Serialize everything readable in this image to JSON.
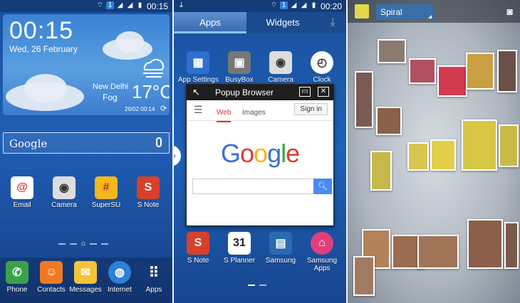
{
  "panel1": {
    "status": {
      "time": "00:15"
    },
    "weather": {
      "time": "00:15",
      "date": "Wed, 26 February",
      "city": "New Delhi",
      "condition": "Fog",
      "temperature": "17°C",
      "updated": "26/02 00:14"
    },
    "search": {
      "label": "Google"
    },
    "apps": [
      {
        "label": "Email",
        "icon": "email-icon",
        "color": "#ffffff"
      },
      {
        "label": "Camera",
        "icon": "camera-icon",
        "color": "#dddddd"
      },
      {
        "label": "SuperSU",
        "icon": "supersu-icon",
        "color": "#f2b81c"
      },
      {
        "label": "S Note",
        "icon": "s-note-icon",
        "color": "#d8402b"
      }
    ],
    "dock": [
      {
        "label": "Phone",
        "icon": "phone-icon",
        "color": "#3aa14a"
      },
      {
        "label": "Contacts",
        "icon": "contacts-icon",
        "color": "#f07a22"
      },
      {
        "label": "Messages",
        "icon": "messages-icon",
        "color": "#f3c43a"
      },
      {
        "label": "Internet",
        "icon": "internet-icon",
        "color": "#2e7fd6"
      },
      {
        "label": "Apps",
        "icon": "apps-grid-icon",
        "color": "#ffffff"
      }
    ]
  },
  "panel2": {
    "status": {
      "time": "00:20"
    },
    "tabs": [
      {
        "label": "Apps",
        "active": true
      },
      {
        "label": "Widgets",
        "active": false
      }
    ],
    "apps_top": [
      {
        "label": "App Settings",
        "icon": "app-settings-icon",
        "color": "#2f6fd0"
      },
      {
        "label": "BusyBox",
        "icon": "busybox-icon",
        "color": "#666666"
      },
      {
        "label": "Camera",
        "icon": "camera-icon",
        "color": "#dddddd"
      },
      {
        "label": "Clock",
        "icon": "clock-icon",
        "color": "#ffffff"
      }
    ],
    "popup": {
      "title": "Popup Browser",
      "tab_web": "Web",
      "tab_images": "Images",
      "signin": "Sign in",
      "logo": "Google"
    },
    "apps_bottom": [
      {
        "label": "S Note",
        "icon": "s-note-icon",
        "color": "#d8402b"
      },
      {
        "label": "S Planner",
        "icon": "s-planner-icon",
        "color": "#ffffff"
      },
      {
        "label": "Samsung",
        "icon": "samsung-icon",
        "color": "#2a6ab0"
      },
      {
        "label": "Samsung Apps",
        "icon": "samsung-apps-icon",
        "color": "#e0407a"
      }
    ]
  },
  "panel3": {
    "mode": "Spiral"
  }
}
